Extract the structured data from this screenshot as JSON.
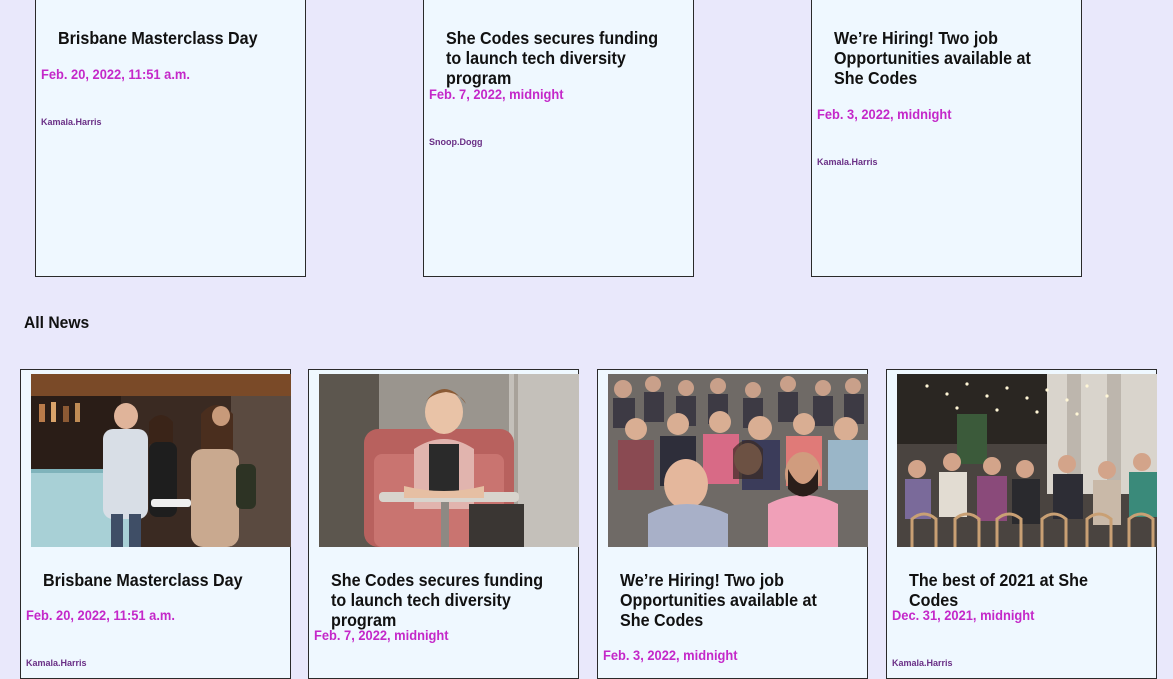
{
  "featured": [
    {
      "title": "Brisbane Masterclass Day",
      "date": "Feb. 20, 2022, 11:51 a.m.",
      "author": "Kamala.Harris"
    },
    {
      "title": "She Codes secures funding to launch tech diversity program",
      "date": "Feb. 7, 2022, midnight",
      "author": "Snoop.Dogg"
    },
    {
      "title": "We’re Hiring! Two job Opportunities available at She Codes",
      "date": "Feb. 3, 2022, midnight",
      "author": "Kamala.Harris"
    }
  ],
  "all_news_heading": "All News",
  "all_news": [
    {
      "title": "Brisbane Masterclass Day",
      "date": "Feb. 20, 2022, 11:51 a.m.",
      "author": "Kamala.Harris",
      "image": "networking-event-photo"
    },
    {
      "title": "She Codes secures funding to launch tech diversity program",
      "date": "Feb. 7, 2022, midnight",
      "author": "",
      "image": "smiling-woman-portrait-photo"
    },
    {
      "title": "We’re Hiring! Two job Opportunities available at She Codes",
      "date": "Feb. 3, 2022, midnight",
      "author": "",
      "image": "seated-audience-photo"
    },
    {
      "title": "The best of 2021 at She Codes",
      "date": "Dec. 31, 2021, midnight",
      "author": "Kamala.Harris",
      "image": "event-hall-audience-photo"
    }
  ],
  "colors": {
    "background": "#e9e8fb",
    "card": "#eff8ff",
    "date": "#c428c9",
    "author": "#6a2f86"
  }
}
